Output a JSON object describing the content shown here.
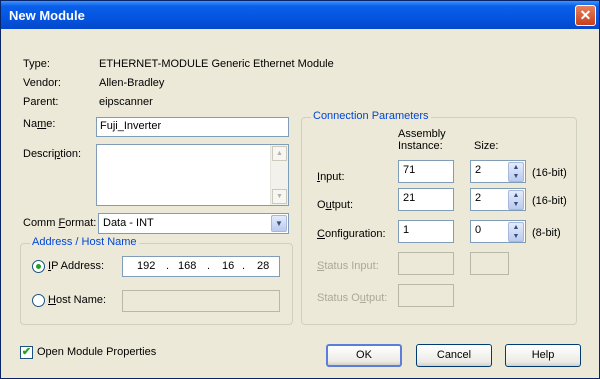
{
  "window": {
    "title": "New Module",
    "close_glyph": "✕"
  },
  "info": {
    "type_label": "Type:",
    "type_value": "ETHERNET-MODULE Generic Ethernet Module",
    "vendor_label": "Vendor:",
    "vendor_value": "Allen-Bradley",
    "parent_label": "Parent:",
    "parent_value": "eipscanner"
  },
  "name": {
    "label_pre": "Na",
    "label_u": "m",
    "label_post": "e:",
    "value": "Fuji_Inverter"
  },
  "description": {
    "label_pre": "Descri",
    "label_u": "p",
    "label_post": "tion:",
    "value": ""
  },
  "comm_format": {
    "label_pre": "Comm ",
    "label_u": "F",
    "label_post": "ormat:",
    "value": "Data - INT"
  },
  "address_group": {
    "title": "Address / Host Name",
    "ip_label_u": "I",
    "ip_label_post": "P Address:",
    "ip": [
      "192",
      "168",
      "16",
      "28"
    ],
    "ip_sep": ".",
    "host_label_u": "H",
    "host_label_post": "ost Name:",
    "host_value": "",
    "selected": "ip"
  },
  "connection": {
    "title": "Connection Parameters",
    "col_assembly_1": "Assembly",
    "col_assembly_2": "Instance:",
    "col_size": "Size:",
    "input": {
      "label_u": "I",
      "label_post": "nput:",
      "instance": "71",
      "size": "2",
      "unit": "(16-bit)"
    },
    "output": {
      "label_pre": "O",
      "label_u": "u",
      "label_post": "tput:",
      "instance": "21",
      "size": "2",
      "unit": "(16-bit)"
    },
    "configuration": {
      "label_u": "C",
      "label_post": "onfiguration:",
      "instance": "1",
      "size": "0",
      "unit": "(8-bit)"
    },
    "status_input": {
      "label_u": "S",
      "label_post": "tatus Input:"
    },
    "status_output": {
      "label_pre": "Status O",
      "label_u": "u",
      "label_post": "tput:"
    }
  },
  "open_props": {
    "label": "Open Module Properties",
    "checked": true,
    "check_glyph": "✔"
  },
  "buttons": {
    "ok": "OK",
    "cancel": "Cancel",
    "help": "Help"
  },
  "glyphs": {
    "up": "▲",
    "down": "▼",
    "dropdown": "▼",
    "scroll_up": "▲",
    "scroll_down": "▼"
  },
  "colors": {
    "title_bar": "#0554E0",
    "group_title": "#0046D5",
    "dialog_bg": "#ECE9D8"
  }
}
